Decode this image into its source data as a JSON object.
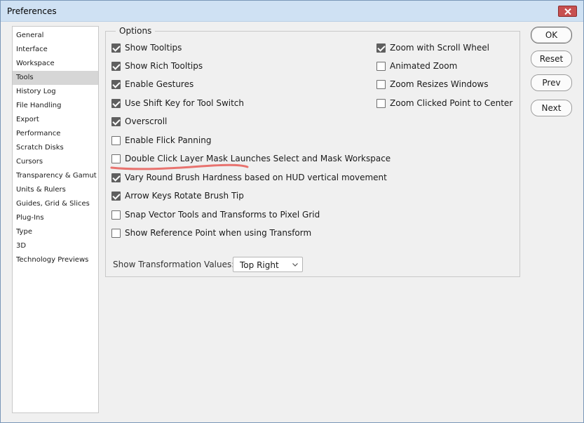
{
  "window": {
    "title": "Preferences"
  },
  "sidebar": {
    "items": [
      {
        "label": "General"
      },
      {
        "label": "Interface"
      },
      {
        "label": "Workspace"
      },
      {
        "label": "Tools",
        "selected": true
      },
      {
        "label": "History Log"
      },
      {
        "label": "File Handling"
      },
      {
        "label": "Export"
      },
      {
        "label": "Performance"
      },
      {
        "label": "Scratch Disks"
      },
      {
        "label": "Cursors"
      },
      {
        "label": "Transparency & Gamut"
      },
      {
        "label": "Units & Rulers"
      },
      {
        "label": "Guides, Grid & Slices"
      },
      {
        "label": "Plug-Ins"
      },
      {
        "label": "Type"
      },
      {
        "label": "3D"
      },
      {
        "label": "Technology Previews"
      }
    ]
  },
  "options": {
    "legend": "Options",
    "left": [
      {
        "label": "Show Tooltips",
        "checked": true
      },
      {
        "label": "Show Rich Tooltips",
        "checked": true
      },
      {
        "label": "Enable Gestures",
        "checked": true
      },
      {
        "label": "Use Shift Key for Tool Switch",
        "checked": true
      },
      {
        "label": "Overscroll",
        "checked": true
      },
      {
        "label": "Enable Flick Panning",
        "checked": false
      },
      {
        "label": "Double Click Layer Mask Launches Select and Mask Workspace",
        "checked": false
      },
      {
        "label": "Vary Round Brush Hardness based on HUD vertical movement",
        "checked": true
      },
      {
        "label": "Arrow Keys Rotate Brush Tip",
        "checked": true
      },
      {
        "label": "Snap Vector Tools and Transforms to Pixel Grid",
        "checked": false
      },
      {
        "label": "Show Reference Point when using Transform",
        "checked": false
      }
    ],
    "right": [
      {
        "label": "Zoom with Scroll Wheel",
        "checked": true
      },
      {
        "label": "Animated Zoom",
        "checked": false
      },
      {
        "label": "Zoom Resizes Windows",
        "checked": false
      },
      {
        "label": "Zoom Clicked Point to Center",
        "checked": false
      }
    ],
    "transformation_values_label": "Show Transformation Values:",
    "transformation_values_selected": "Top Right"
  },
  "buttons": {
    "ok": "OK",
    "reset": "Reset",
    "prev": "Prev",
    "next": "Next"
  },
  "colors": {
    "annotation_underline": "#e8736f",
    "checkbox_checked": "#5f5f5f",
    "close_button": "#c75050"
  }
}
